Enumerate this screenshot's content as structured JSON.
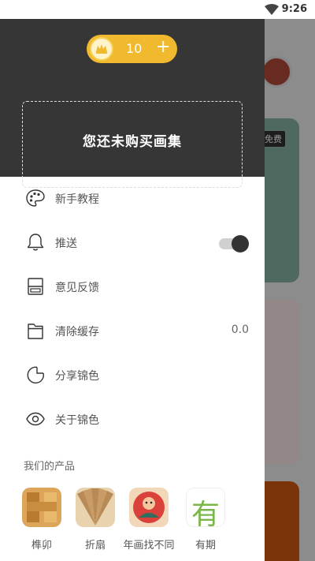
{
  "status_bar": {
    "time": "9:26"
  },
  "background": {
    "free_badge": "免费"
  },
  "drawer": {
    "coins": {
      "count": "10",
      "plus": "+"
    },
    "album_notice": "您还未购买画集",
    "menu": [
      {
        "label": "新手教程",
        "icon": "palette-icon"
      },
      {
        "label": "推送",
        "icon": "bell-icon",
        "toggle_on": true
      },
      {
        "label": "意见反馈",
        "icon": "feedback-icon"
      },
      {
        "label": "清除缓存",
        "icon": "folder-icon",
        "value": "0.0"
      },
      {
        "label": "分享锦色",
        "icon": "share-icon"
      },
      {
        "label": "关于锦色",
        "icon": "eye-icon"
      }
    ],
    "products_title": "我们的产品",
    "products": [
      {
        "label": "榫卯",
        "icon": "mortise-app-icon",
        "color": "#c8903e"
      },
      {
        "label": "折扇",
        "icon": "fan-app-icon",
        "color": "#c9a87a"
      },
      {
        "label": "年画找不同",
        "icon": "new-year-painting-app-icon",
        "color": "#d9413a"
      },
      {
        "label": "有期",
        "icon": "youqi-app-icon",
        "color": "#7ab648",
        "glyph": "有"
      }
    ]
  },
  "colors": {
    "header_bg": "#363636",
    "coin_gold": "#f0b92e",
    "toggle_knob": "#333333"
  }
}
